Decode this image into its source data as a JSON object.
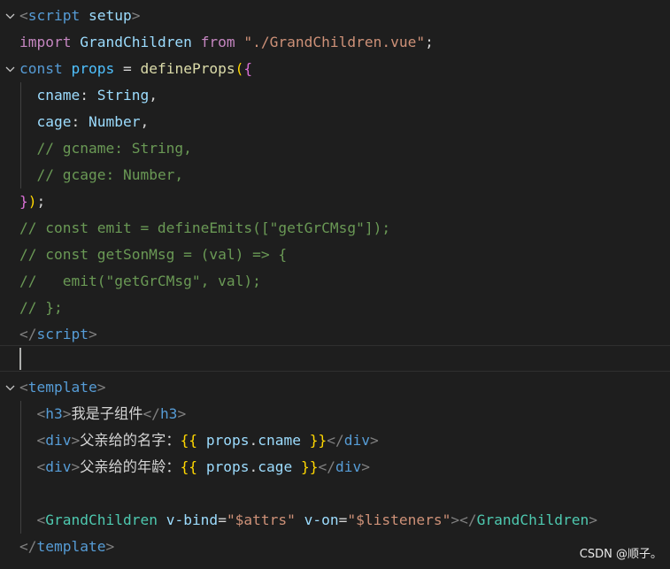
{
  "editor": {
    "language": "vue",
    "theme": "dark",
    "accent_colors": {
      "background": "#1e1e1e",
      "keyword": "#c586c0",
      "tag": "#569cd6",
      "string": "#ce9178",
      "comment": "#6a9955",
      "function": "#dcdcaa",
      "type": "#4ec9b0",
      "variable": "#9cdcfe"
    }
  },
  "lines": [
    {
      "tokens": [
        {
          "c": "tag",
          "t": "<"
        },
        {
          "c": "tagname",
          "t": "script"
        },
        {
          "c": "text",
          "t": " "
        },
        {
          "c": "attr",
          "t": "setup"
        },
        {
          "c": "tag",
          "t": ">"
        }
      ]
    },
    {
      "tokens": [
        {
          "c": "keyword",
          "t": "import"
        },
        {
          "c": "text",
          "t": " "
        },
        {
          "c": "prop",
          "t": "GrandChildren"
        },
        {
          "c": "text",
          "t": " "
        },
        {
          "c": "keyword",
          "t": "from"
        },
        {
          "c": "text",
          "t": " "
        },
        {
          "c": "string",
          "t": "\"./GrandChildren.vue\""
        },
        {
          "c": "punct",
          "t": ";"
        }
      ]
    },
    {
      "tokens": [
        {
          "c": "storage",
          "t": "const"
        },
        {
          "c": "text",
          "t": " "
        },
        {
          "c": "var",
          "t": "props"
        },
        {
          "c": "text",
          "t": " = "
        },
        {
          "c": "func",
          "t": "defineProps"
        },
        {
          "c": "brace1",
          "t": "("
        },
        {
          "c": "brace2",
          "t": "{"
        }
      ]
    },
    {
      "tokens": [
        {
          "c": "text",
          "t": "  "
        },
        {
          "c": "prop",
          "t": "cname"
        },
        {
          "c": "punct",
          "t": ": "
        },
        {
          "c": "prop",
          "t": "String"
        },
        {
          "c": "punct",
          "t": ","
        }
      ]
    },
    {
      "tokens": [
        {
          "c": "text",
          "t": "  "
        },
        {
          "c": "prop",
          "t": "cage"
        },
        {
          "c": "punct",
          "t": ": "
        },
        {
          "c": "prop",
          "t": "Number"
        },
        {
          "c": "punct",
          "t": ","
        }
      ]
    },
    {
      "tokens": [
        {
          "c": "text",
          "t": "  "
        },
        {
          "c": "comment",
          "t": "// gcname: String,"
        }
      ]
    },
    {
      "tokens": [
        {
          "c": "text",
          "t": "  "
        },
        {
          "c": "comment",
          "t": "// gcage: Number,"
        }
      ]
    },
    {
      "tokens": [
        {
          "c": "brace2",
          "t": "}"
        },
        {
          "c": "brace1",
          "t": ")"
        },
        {
          "c": "punct",
          "t": ";"
        }
      ]
    },
    {
      "tokens": [
        {
          "c": "comment",
          "t": "// const emit = defineEmits([\"getGrCMsg\"]);"
        }
      ]
    },
    {
      "tokens": [
        {
          "c": "comment",
          "t": "// const getSonMsg = (val) => {"
        }
      ]
    },
    {
      "tokens": [
        {
          "c": "comment",
          "t": "//   emit(\"getGrCMsg\", val);"
        }
      ]
    },
    {
      "tokens": [
        {
          "c": "comment",
          "t": "// };"
        }
      ]
    },
    {
      "tokens": [
        {
          "c": "tag",
          "t": "</"
        },
        {
          "c": "tagname",
          "t": "script"
        },
        {
          "c": "tag",
          "t": ">"
        }
      ]
    },
    {
      "tokens": []
    },
    {
      "tokens": [
        {
          "c": "tag",
          "t": "<"
        },
        {
          "c": "tagname",
          "t": "template"
        },
        {
          "c": "tag",
          "t": ">"
        }
      ]
    },
    {
      "tokens": [
        {
          "c": "text",
          "t": "  "
        },
        {
          "c": "tag",
          "t": "<"
        },
        {
          "c": "tagname",
          "t": "h3"
        },
        {
          "c": "tag",
          "t": ">"
        },
        {
          "c": "text",
          "t": "我是子组件"
        },
        {
          "c": "tag",
          "t": "</"
        },
        {
          "c": "tagname",
          "t": "h3"
        },
        {
          "c": "tag",
          "t": ">"
        }
      ]
    },
    {
      "tokens": [
        {
          "c": "text",
          "t": "  "
        },
        {
          "c": "tag",
          "t": "<"
        },
        {
          "c": "tagname",
          "t": "div"
        },
        {
          "c": "tag",
          "t": ">"
        },
        {
          "c": "text",
          "t": "父亲给的名字："
        },
        {
          "c": "brace1",
          "t": "{{"
        },
        {
          "c": "text",
          "t": " "
        },
        {
          "c": "prop",
          "t": "props"
        },
        {
          "c": "punct",
          "t": "."
        },
        {
          "c": "prop",
          "t": "cname"
        },
        {
          "c": "text",
          "t": " "
        },
        {
          "c": "brace1",
          "t": "}}"
        },
        {
          "c": "tag",
          "t": "</"
        },
        {
          "c": "tagname",
          "t": "div"
        },
        {
          "c": "tag",
          "t": ">"
        }
      ]
    },
    {
      "tokens": [
        {
          "c": "text",
          "t": "  "
        },
        {
          "c": "tag",
          "t": "<"
        },
        {
          "c": "tagname",
          "t": "div"
        },
        {
          "c": "tag",
          "t": ">"
        },
        {
          "c": "text",
          "t": "父亲给的年龄："
        },
        {
          "c": "brace1",
          "t": "{{"
        },
        {
          "c": "text",
          "t": " "
        },
        {
          "c": "prop",
          "t": "props"
        },
        {
          "c": "punct",
          "t": "."
        },
        {
          "c": "prop",
          "t": "cage"
        },
        {
          "c": "text",
          "t": " "
        },
        {
          "c": "brace1",
          "t": "}}"
        },
        {
          "c": "tag",
          "t": "</"
        },
        {
          "c": "tagname",
          "t": "div"
        },
        {
          "c": "tag",
          "t": ">"
        }
      ]
    },
    {
      "tokens": []
    },
    {
      "tokens": [
        {
          "c": "text",
          "t": "  "
        },
        {
          "c": "tag",
          "t": "<"
        },
        {
          "c": "comp",
          "t": "GrandChildren"
        },
        {
          "c": "text",
          "t": " "
        },
        {
          "c": "attr",
          "t": "v-bind"
        },
        {
          "c": "punct",
          "t": "="
        },
        {
          "c": "string",
          "t": "\"$attrs\""
        },
        {
          "c": "text",
          "t": " "
        },
        {
          "c": "attr",
          "t": "v-on"
        },
        {
          "c": "punct",
          "t": "="
        },
        {
          "c": "string",
          "t": "\"$listeners\""
        },
        {
          "c": "tag",
          "t": "></"
        },
        {
          "c": "comp",
          "t": "GrandChildren"
        },
        {
          "c": "tag",
          "t": ">"
        }
      ]
    },
    {
      "tokens": [
        {
          "c": "tag",
          "t": "</"
        },
        {
          "c": "tagname",
          "t": "template"
        },
        {
          "c": "tag",
          "t": ">"
        }
      ]
    }
  ],
  "folds": [
    {
      "line": 0,
      "icon": "chevron-down-icon"
    },
    {
      "line": 2,
      "icon": "chevron-down-icon"
    },
    {
      "line": 14,
      "icon": "chevron-down-icon"
    }
  ],
  "active_line": 13,
  "watermark": "CSDN @顺子。"
}
